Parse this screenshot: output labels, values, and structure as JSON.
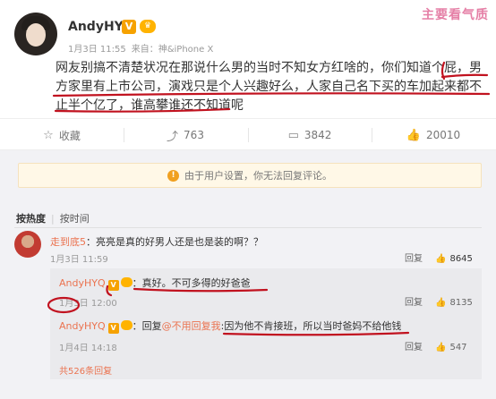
{
  "post": {
    "author": "AndyHYQ",
    "v_badge": "V",
    "crown_badge": "♛",
    "date": "1月3日 11:55",
    "source_label": "来自：",
    "device": "神&iPhone X",
    "watermark": "主要看气质",
    "text": "网友别搞不清楚状况在那说什么男的当时不知女方红啥的，你们知道个屁，男方家里有上市公司，演戏只是个人兴趣好么，人家自己名下买的车加起来都不止半个亿了，谁高攀谁还不知道呢"
  },
  "actions": {
    "favorite": {
      "icon": "star-outline-icon",
      "label": "收藏"
    },
    "repost": {
      "icon": "repost-icon",
      "count": "763"
    },
    "comment": {
      "icon": "comment-icon",
      "count": "3842"
    },
    "like": {
      "icon": "thumb-up-icon",
      "count": "20010"
    }
  },
  "notice": {
    "icon": "warning-icon",
    "text": "由于用户设置，你无法回复评论。"
  },
  "sort": {
    "hot": "按热度",
    "time": "按时间"
  },
  "comments": [
    {
      "user": "走到底5",
      "sep": "：",
      "text": "亮亮是真的好男人还是也是装的啊？？",
      "date": "1月3日 11:59",
      "reply_label": "回复",
      "likes": "8645",
      "replies": [
        {
          "user": "AndyHYQ",
          "sep": "：",
          "text": "真好。不可多得的好爸爸",
          "date": "1月3日 12:00",
          "reply_label": "回复",
          "likes": "8135"
        },
        {
          "user": "AndyHYQ",
          "sep": "：",
          "prefix": "回复",
          "mention": "@不用回复我",
          "mention_sep": ":",
          "text": "因为他不肯接班，所以当时爸妈不给他钱",
          "date": "1月4日 14:18",
          "reply_label": "回复",
          "likes": "547"
        }
      ],
      "more_replies": "共526条回复"
    }
  ],
  "colors": {
    "annotation_red": "#c1121f",
    "link_orange": "#eb7350",
    "badge_gold": "#f6a200"
  }
}
